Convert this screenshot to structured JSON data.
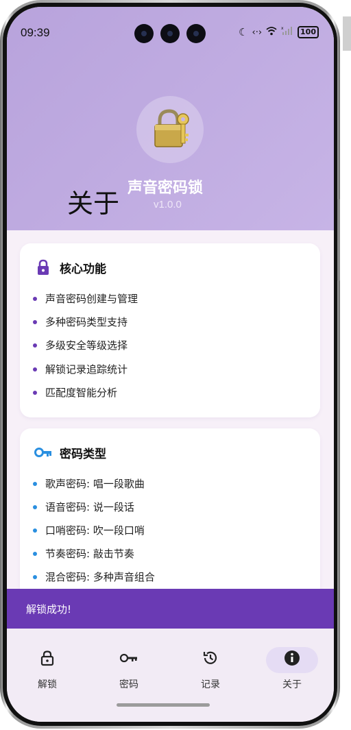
{
  "status_bar": {
    "time": "09:39",
    "icons": [
      "moon-icon",
      "data-sync-icon",
      "wifi-icon",
      "signal-icon"
    ],
    "battery": "100"
  },
  "header": {
    "page_title": "关于",
    "app_name": "声音密码锁",
    "version": "v1.0.0",
    "logo_icon": "padlock-key-icon"
  },
  "cards": {
    "core_features": {
      "title": "核心功能",
      "icon": "lock-icon",
      "items": [
        "声音密码创建与管理",
        "多种密码类型支持",
        "多级安全等级选择",
        "解锁记录追踪统计",
        "匹配度智能分析"
      ]
    },
    "password_types": {
      "title": "密码类型",
      "icon": "key-icon",
      "items": [
        "歌声密码: 唱一段歌曲",
        "语音密码: 说一段话",
        "口哨密码: 吹一段口哨",
        "节奏密码: 敲击节奏",
        "混合密码: 多种声音组合"
      ]
    }
  },
  "snackbar": {
    "message": "解锁成功!"
  },
  "bottom_nav": {
    "items": [
      {
        "label": "解锁",
        "icon": "lock-icon"
      },
      {
        "label": "密码",
        "icon": "key-icon"
      },
      {
        "label": "记录",
        "icon": "history-icon"
      },
      {
        "label": "关于",
        "icon": "info-icon"
      }
    ],
    "selected": "关于"
  },
  "colors": {
    "accent": "#6a3ab4",
    "header_bg": "#bca7df",
    "blue_bullet": "#2a8fe0",
    "nav_bg": "#f2ebf5"
  }
}
